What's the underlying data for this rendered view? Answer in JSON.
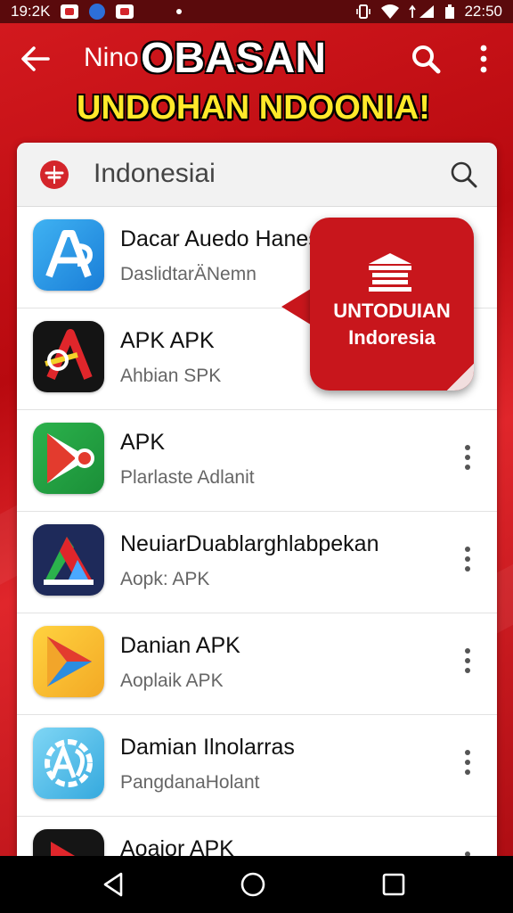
{
  "status_bar": {
    "time_left": "19:2K",
    "time_right": "22:50"
  },
  "header": {
    "prefix": "Nino",
    "title": "OBASAN",
    "subtitle": "UNDOHAN NDOONIA!"
  },
  "search": {
    "text": "Indonesiai"
  },
  "apps": [
    {
      "name": "Dacar Auedo Hanesm",
      "sub": "DaslidtarÄNemn"
    },
    {
      "name": "APK APK",
      "sub": "Ahbian SPK"
    },
    {
      "name": "APK",
      "sub": "Plarlaste Adlanit"
    },
    {
      "name": "NeuiarDuablarghlabpekan",
      "sub": "Aopk: APK"
    },
    {
      "name": "Danian APK",
      "sub": "Aoplaik APK"
    },
    {
      "name": "Damian Ilnolarras",
      "sub": "PangdanaHolant"
    },
    {
      "name": "Aoaior APK",
      "sub": ""
    }
  ],
  "promo": {
    "title": "UNTODUIAN",
    "subtitle": "Indoresia"
  },
  "colors": {
    "brand_red": "#c8161c",
    "header_yellow": "#ffe92a",
    "status_bar": "#5a0a0c"
  }
}
